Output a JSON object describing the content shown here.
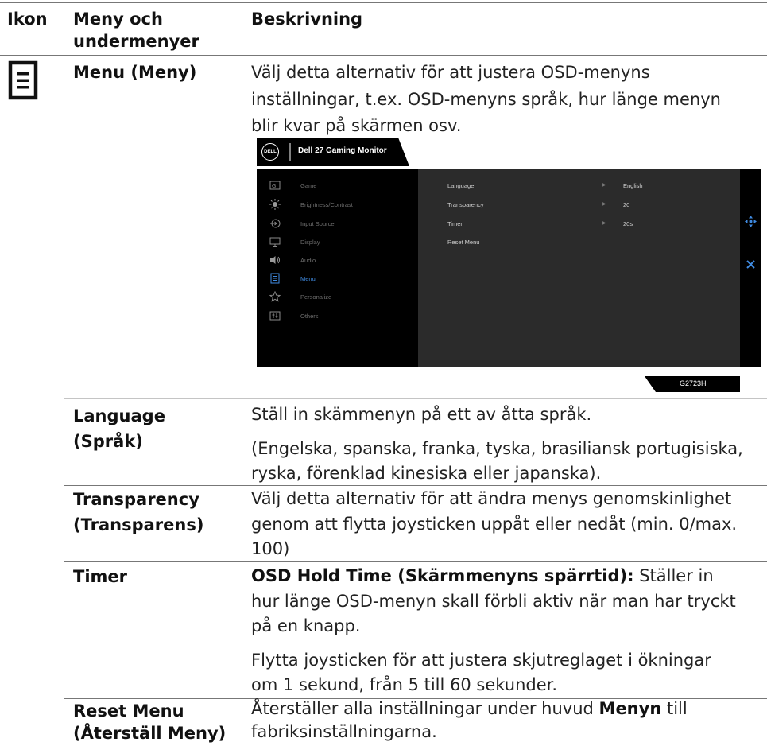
{
  "table": {
    "headers": [
      "Ikon",
      "Meny och undermenyer",
      "Beskrivning"
    ],
    "rows": {
      "menu": {
        "name": "Menu (Meny)",
        "desc_lines": [
          "Välj detta alternativ för att justera OSD-menyns",
          "inställningar, t.ex. OSD-menyns språk, hur länge menyn",
          "blir kvar på skärmen osv."
        ]
      },
      "language": {
        "name_lines": [
          "Language",
          "(Språk)"
        ],
        "desc1": "Ställ in skämmenyn på ett av åtta språk.",
        "desc2_lines": [
          "(Engelska, spanska, franka, tyska, brasiliansk portugisiska,",
          "ryska, förenklad kinesiska eller japanska)."
        ]
      },
      "transparency": {
        "name_lines": [
          "Transparency",
          "(Transparens)"
        ],
        "desc_lines": [
          "Välj detta alternativ för att ändra menys genomskinlighet",
          "genom att flytta joysticken uppåt eller nedåt (min. 0/max.",
          "100)"
        ]
      },
      "timer": {
        "name": "Timer",
        "bold": "OSD Hold Time (Skärmmenyns spärrtid):",
        "desc_line1_rest": " Ställer in",
        "desc_lines": [
          "hur länge OSD-menyn skall förbli aktiv när man har tryckt",
          "på en knapp."
        ],
        "desc2_lines": [
          "Flytta joysticken för att justera skjutreglaget i ökningar",
          "om 1 sekund, från 5 till 60 sekunder."
        ]
      },
      "reset": {
        "name_lines": [
          "Reset Menu",
          "(Återställ Meny)"
        ],
        "desc_pre": "Återställer alla inställningar under huvud ",
        "desc_bold": "Menyn",
        "desc_post": " till",
        "desc_line2": "fabriksinställningarna."
      }
    }
  },
  "osd": {
    "brand": "DELL",
    "title": "Dell 27 Gaming Monitor",
    "model": "G2723H",
    "menu_items": [
      {
        "label": "Game",
        "icon": "game-icon"
      },
      {
        "label": "Brightness/Contrast",
        "icon": "brightness-icon"
      },
      {
        "label": "Input Source",
        "icon": "input-source-icon"
      },
      {
        "label": "Display",
        "icon": "display-icon"
      },
      {
        "label": "Audio",
        "icon": "audio-icon"
      },
      {
        "label": "Menu",
        "icon": "menu-icon",
        "active": true
      },
      {
        "label": "Personalize",
        "icon": "star-icon"
      },
      {
        "label": "Others",
        "icon": "others-icon"
      }
    ],
    "submenu": [
      {
        "label": "Language",
        "value": "English"
      },
      {
        "label": "Transparency",
        "value": "20"
      },
      {
        "label": "Timer",
        "value": "20s"
      },
      {
        "label": "Reset Menu",
        "value": ""
      }
    ],
    "colors": {
      "accent": "#3f8ae0",
      "panel": "#2b2b2b",
      "background": "#000000"
    }
  }
}
